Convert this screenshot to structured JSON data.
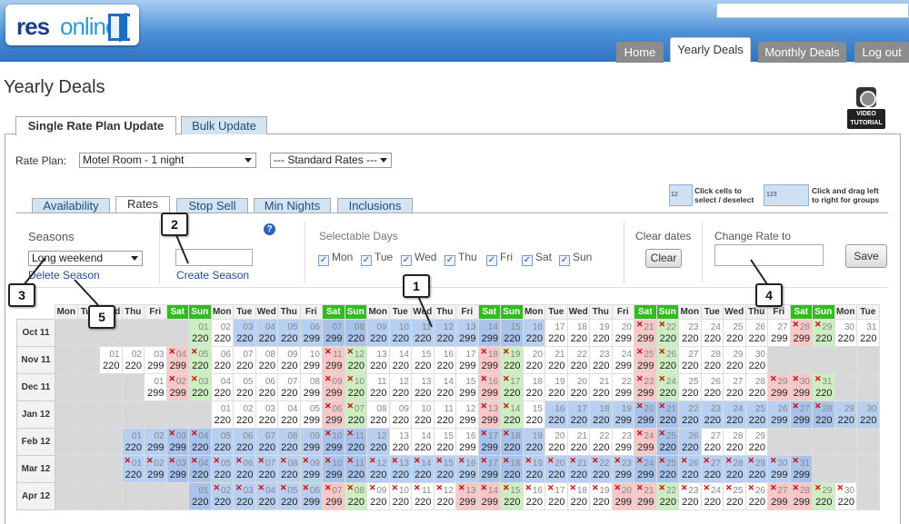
{
  "header": {
    "logo": {
      "part1": "res",
      "part2": "online"
    },
    "nav": [
      {
        "label": "Home",
        "active": false
      },
      {
        "label": "Yearly Deals",
        "active": true
      },
      {
        "label": "Monthly Deals",
        "active": false
      },
      {
        "label": "Log out",
        "active": false
      }
    ]
  },
  "page": {
    "title": "Yearly Deals",
    "video_tutorial": "VIDEO TUTORIAL",
    "tabs": [
      {
        "label": "Single Rate Plan Update",
        "active": true
      },
      {
        "label": "Bulk Update",
        "active": false
      }
    ]
  },
  "rate_plan": {
    "label": "Rate Plan:",
    "selected": "Motel Room - 1 night",
    "rates_selected": "--- Standard Rates ---"
  },
  "subtabs": [
    {
      "label": "Availability",
      "active": false
    },
    {
      "label": "Rates",
      "active": true
    },
    {
      "label": "Stop Sell",
      "active": false
    },
    {
      "label": "Min Nights",
      "active": false
    },
    {
      "label": "Inclusions",
      "active": false
    }
  ],
  "hints": {
    "click": "Click cells to select / deselect",
    "drag": "Click and drag left to right for groups",
    "click_img": "12",
    "drag_img": "123"
  },
  "seasons": {
    "label": "Seasons",
    "selected": "Long weekend",
    "delete_link": "Delete Season",
    "create_link": "Create Season",
    "help": "?"
  },
  "selectable_days": {
    "label": "Selectable Days",
    "days": [
      "Mon",
      "Tue",
      "Wed",
      "Thu",
      "Fri",
      "Sat",
      "Sun"
    ],
    "check": "✓"
  },
  "clear": {
    "label": "Clear dates",
    "button": "Clear"
  },
  "change_rate": {
    "label": "Change Rate to",
    "button": "Save"
  },
  "callouts": [
    "1",
    "2",
    "3",
    "4",
    "5"
  ],
  "colors": {
    "weekend_header": "#33bb22",
    "selected": "#b7cff0",
    "saturday": "#f8c8c8",
    "sunday": "#cdeec0",
    "empty": "#d8d8d8",
    "stop_sell": "#d40000"
  },
  "calendar": {
    "header": [
      "Mon",
      "Tue",
      "Wed",
      "Thu",
      "Fri",
      "Sat",
      "Sun",
      "Mon",
      "Tue",
      "Wed",
      "Thu",
      "Fri",
      "Sat",
      "Sun",
      "Mon",
      "Tue",
      "Wed",
      "Thu",
      "Fri",
      "Sat",
      "Sun",
      "Mon",
      "Tue",
      "Wed",
      "Thu",
      "Fri",
      "Sat",
      "Sun",
      "Mon",
      "Tue",
      "Wed",
      "Thu",
      "Fri",
      "Sat",
      "Sun",
      "Mon",
      "Tue"
    ],
    "x_mark": "✕",
    "months": [
      {
        "label": "Oct 11",
        "offset": 6,
        "days": 31,
        "sel": [
          3,
          4,
          5,
          6,
          7,
          8,
          9,
          10,
          11,
          12,
          13,
          14,
          15,
          16
        ],
        "x": [
          21,
          22,
          28,
          29
        ]
      },
      {
        "label": "Nov 11",
        "offset": 2,
        "days": 30,
        "sel": [],
        "x": [
          4,
          5,
          11,
          12,
          18,
          19,
          25,
          26
        ]
      },
      {
        "label": "Dec 11",
        "offset": 4,
        "days": 31,
        "sel": [],
        "x": [
          2,
          3,
          9,
          10,
          16,
          17,
          23,
          24,
          29,
          30,
          31
        ]
      },
      {
        "label": "Jan 12",
        "offset": 7,
        "days": 31,
        "sel": [
          16,
          17,
          18,
          19,
          20,
          21,
          22,
          23,
          24,
          25,
          26,
          27,
          28,
          29,
          30,
          31
        ],
        "x": [
          6,
          7,
          13,
          14,
          20,
          21,
          27,
          28
        ]
      },
      {
        "label": "Feb 12",
        "offset": 3,
        "days": 29,
        "sel": [
          1,
          2,
          3,
          4,
          5,
          6,
          7,
          8,
          9,
          10,
          11,
          12,
          17,
          18,
          19,
          25,
          26
        ],
        "x": [
          3,
          4,
          10,
          11,
          17,
          18,
          24,
          25
        ]
      },
      {
        "label": "Mar 12",
        "offset": 3,
        "days": 31,
        "sel": [
          1,
          2,
          3,
          4,
          5,
          6,
          7,
          8,
          9,
          10,
          11,
          12,
          13,
          14,
          15,
          16,
          17,
          18,
          19,
          20,
          21,
          22,
          23,
          24,
          25,
          26,
          27,
          28,
          29,
          30,
          31
        ],
        "x": [
          1,
          2,
          3,
          4,
          5,
          6,
          7,
          8,
          9,
          10,
          11,
          12,
          13,
          14,
          15,
          16,
          17,
          18,
          19,
          20,
          21,
          22,
          23,
          24,
          25,
          26,
          27,
          28,
          29,
          30,
          31
        ]
      },
      {
        "label": "Apr 12",
        "offset": 6,
        "days": 30,
        "sel": [
          1,
          2,
          3,
          4,
          5,
          6
        ],
        "x": [
          2,
          3,
          4,
          5,
          6,
          7,
          8,
          9,
          10,
          11,
          12,
          13,
          14,
          15,
          16,
          17,
          18,
          19,
          20,
          21,
          22,
          23,
          24,
          25,
          26,
          27,
          28,
          29,
          30
        ]
      }
    ],
    "rates": {
      "weekday": "220",
      "weekend": "299"
    }
  }
}
